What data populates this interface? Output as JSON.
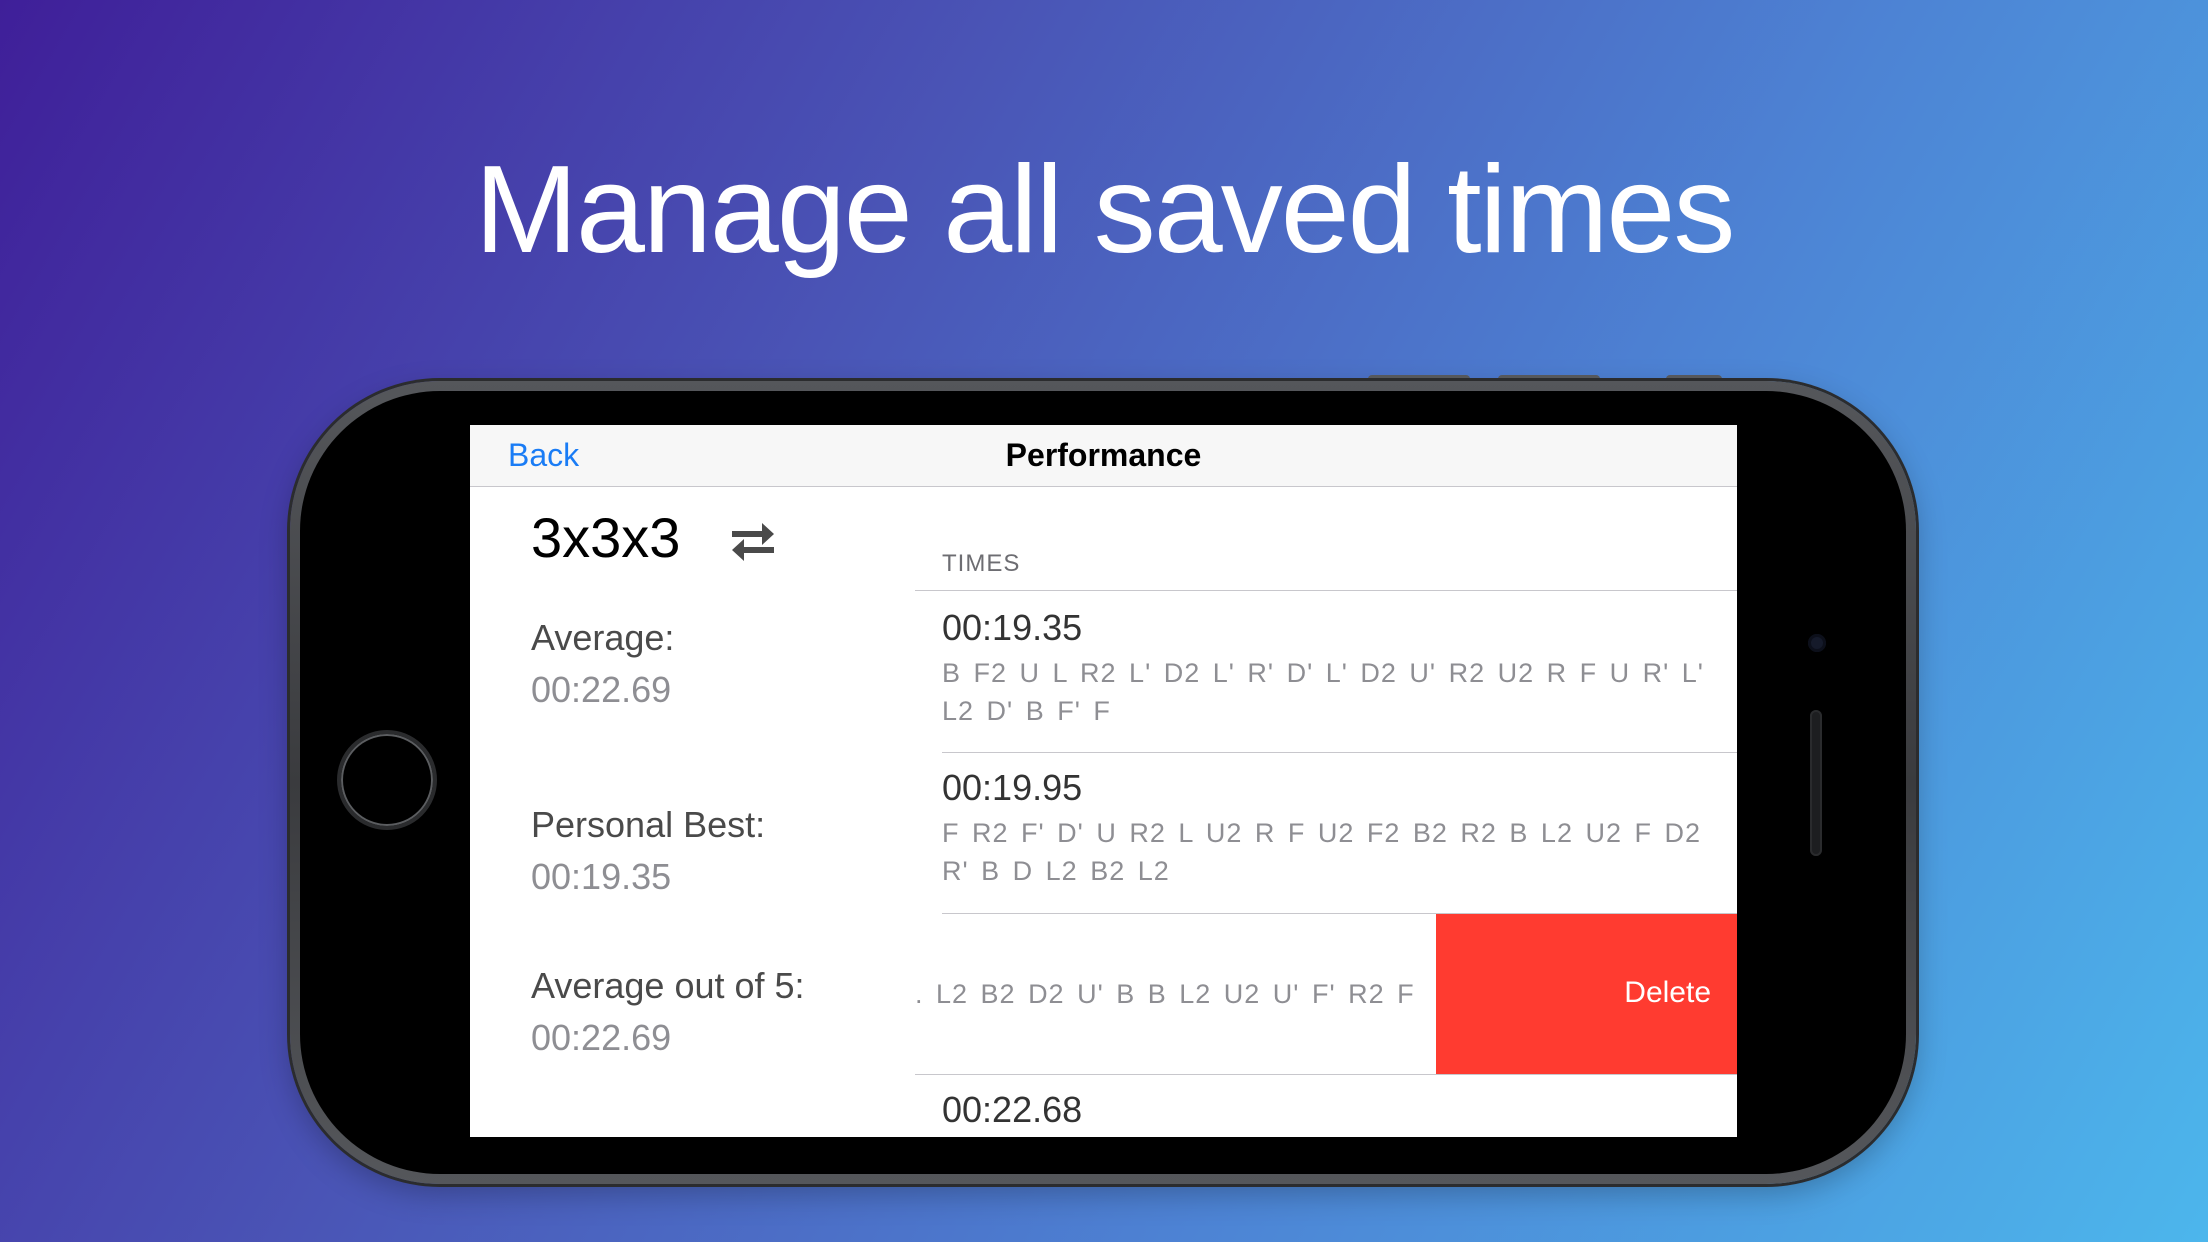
{
  "headline": "Manage all saved times",
  "nav": {
    "back_label": "Back",
    "title": "Performance"
  },
  "left": {
    "puzzle": "3x3x3",
    "swap_icon": "swap-arrows-icon",
    "average_label": "Average:",
    "average_value": "00:22.69",
    "best_label": "Personal Best:",
    "best_value": "00:19.35",
    "ao5_label": "Average out of 5:",
    "ao5_value": "00:22.69"
  },
  "times": {
    "header": "TIMES",
    "rows": [
      {
        "time": "00:19.35",
        "scramble": "B F2 U L R2 L' D2 L' R' D' L' D2 U' R2 U2 R F U R' L' L2 D' B F' F"
      },
      {
        "time": "00:19.95",
        "scramble": "F R2 F' D' U R2 L U2 R F U2 F2 B2 R2 B L2 U2 F D2 R' B D L2 B2 L2"
      },
      {
        "time": "",
        "scramble": ". L2 B2 D2 U' B B L2 U2 U' F' R2 F"
      },
      {
        "time": "00:22.68",
        "scramble": ""
      }
    ],
    "delete_label": "Delete"
  },
  "colors": {
    "accent": "#1a7cf5",
    "delete": "#ff3b30",
    "background_start": "#3f1f99",
    "background_end": "#4cb6ec"
  }
}
